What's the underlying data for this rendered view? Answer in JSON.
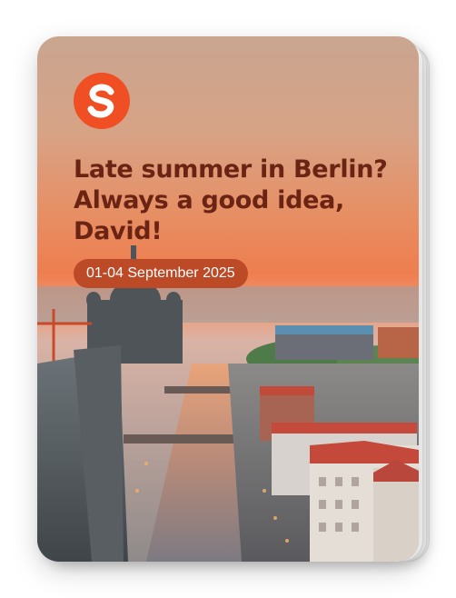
{
  "card": {
    "headline": "Late summer in Berlin? Always a good idea, David!",
    "dates": "01-04 September 2025",
    "logo_icon": "s-brand-logo-icon",
    "brand_color": "#f04e23",
    "headline_color": "#6b2413",
    "pill_color": "#bc4a27"
  }
}
